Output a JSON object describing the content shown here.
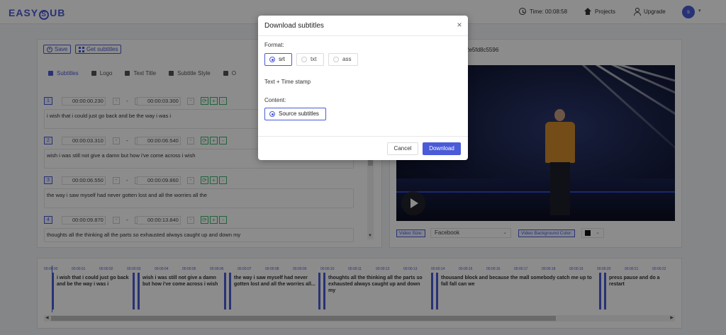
{
  "header": {
    "logo_left": "EASY",
    "logo_mark": "S",
    "logo_right": "UB",
    "time_label": "Time: 00:08:58",
    "projects_label": "Projects",
    "upgrade_label": "Upgrade",
    "avatar_initial": "s"
  },
  "toolbar": {
    "save_label": "Save",
    "get_subtitles_label": "Get subtitles"
  },
  "tabs": [
    {
      "label": "Subtitles"
    },
    {
      "label": "Logo"
    },
    {
      "label": "Text Title"
    },
    {
      "label": "Subtitle Style"
    },
    {
      "label": "O"
    }
  ],
  "subtitles": [
    {
      "index": "1",
      "start": "00:00:00.230",
      "end": "00:00:03.300",
      "text": "i wish that i could just go back and be the way i was i"
    },
    {
      "index": "2",
      "start": "00:00:03.310",
      "end": "00:00:06.540",
      "text": "wish i was still not give a damn but how i've come across i wish"
    },
    {
      "index": "3",
      "start": "00:00:06.550",
      "end": "00:00:09.860",
      "text": "the way i saw myself had never gotten lost and all the worries all the"
    },
    {
      "index": "4",
      "start": "00:00:09.870",
      "end": "00:00:13.840",
      "text": "thoughts all the thinking all the parts so exhausted always caught up and down my"
    }
  ],
  "controls": {
    "minus": "-",
    "plus": "+",
    "dash": "-",
    "refresh": "⟳"
  },
  "video": {
    "id_fragment": "2e5fd8c5596",
    "size_label": "Video Size:",
    "size_value": "Facebook",
    "bg_label": "Video Background Color:",
    "bg_color": "#111111"
  },
  "timeline": {
    "ticks": [
      "00:00:00",
      "00:00:01",
      "00:00:02",
      "00:00:03",
      "00:00:04",
      "00:00:05",
      "00:00:06",
      "00:00:07",
      "00:00:08",
      "00:00:09",
      "00:00:10",
      "00:00:11",
      "00:00:12",
      "00:00:13",
      "00:00:14",
      "00:00:15",
      "00:00:16",
      "00:00:17",
      "00:00:18",
      "00:00:19",
      "00:00:20",
      "00:00:21",
      "00:00:22"
    ],
    "blocks": [
      {
        "text": "i wish that i could just go back and be the way i was i"
      },
      {
        "text": "wish i was still not give a damn but how i've come across i wish"
      },
      {
        "text": "the way i saw myself had never gotten lost and all the worries all..."
      },
      {
        "text": "thoughts all the thinking all the parts so exhausted always caught up and down my"
      },
      {
        "text": "thousand block and because the mall somebody catch me up to fall fall can we"
      },
      {
        "text": "press pause and do a restart"
      }
    ]
  },
  "modal": {
    "title": "Download subtitles",
    "close": "×",
    "format_label": "Format:",
    "formats": [
      "srt",
      "txt",
      "ass"
    ],
    "selected_format": "srt",
    "mode_text": "Text + Time stamp",
    "content_label": "Content:",
    "content_option": "Source subtitles",
    "cancel_label": "Cancel",
    "download_label": "Download"
  },
  "colors": {
    "accent": "#4a5bd8",
    "success": "#3bb46e"
  }
}
